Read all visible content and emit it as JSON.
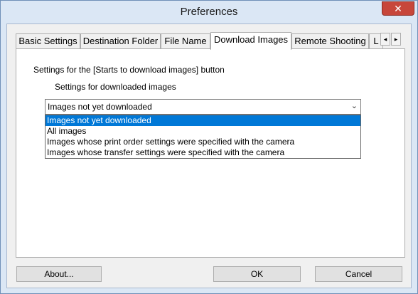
{
  "window": {
    "title": "Preferences",
    "close_glyph": "✕"
  },
  "tabs": [
    {
      "label": "Basic Settings"
    },
    {
      "label": "Destination Folder"
    },
    {
      "label": "File Name"
    },
    {
      "label": "Download Images"
    },
    {
      "label": "Remote Shooting"
    },
    {
      "label": "L"
    }
  ],
  "tab_scroll": {
    "left": "◂",
    "right": "▸"
  },
  "panel": {
    "heading": "Settings for the [Starts to download images] button",
    "sublabel": "Settings for downloaded images",
    "combo": {
      "value": "Images not yet downloaded",
      "arrow": "⌄",
      "options": [
        "Images not yet downloaded",
        "All images",
        "Images whose print order settings were specified with the camera",
        "Images whose transfer settings were specified with the camera"
      ]
    }
  },
  "buttons": {
    "about": "About...",
    "ok": "OK",
    "cancel": "Cancel"
  }
}
